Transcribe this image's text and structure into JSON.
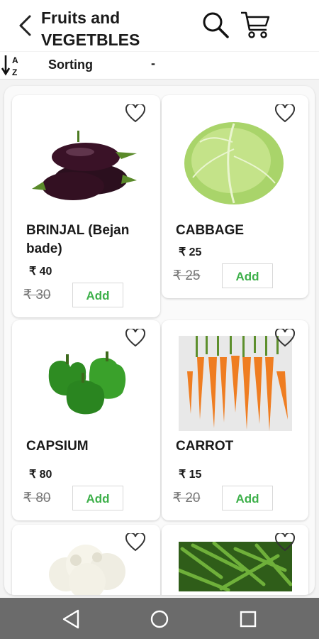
{
  "header": {
    "title_line1": "Fruits and",
    "title_line2": "VEGETBLES"
  },
  "icons": {
    "back": "chevron-left-icon",
    "search": "search-icon",
    "cart": "cart-icon",
    "sort": "sort-az-icon",
    "wishlist": "heart-icon"
  },
  "sortbar": {
    "label": "Sorting",
    "value": "-"
  },
  "currency": "₹",
  "products": [
    {
      "name_line1": "BRINJAL (Bejan",
      "name_line2": "bade)",
      "price": "₹ 40",
      "mrp": "₹ 30",
      "add_label": "Add"
    },
    {
      "name_line1": "CABBAGE",
      "name_line2": "",
      "price": "₹ 25",
      "mrp": "₹ 25",
      "add_label": "Add"
    },
    {
      "name_line1": "CAPSIUM",
      "name_line2": "",
      "price": "₹ 80",
      "mrp": "₹ 80",
      "add_label": "Add"
    },
    {
      "name_line1": "CARROT",
      "name_line2": "",
      "price": "₹ 15",
      "mrp": "₹ 20",
      "add_label": "Add"
    },
    {
      "name_line1": "",
      "name_line2": "",
      "price": "",
      "mrp": "",
      "add_label": ""
    },
    {
      "name_line1": "",
      "name_line2": "",
      "price": "",
      "mrp": "",
      "add_label": ""
    }
  ],
  "colors": {
    "accent_green": "#3db04a",
    "nav_bar": "#6b6b6b"
  },
  "system_nav": {
    "back": "nav-back-icon",
    "home": "nav-home-icon",
    "recents": "nav-recents-icon"
  }
}
